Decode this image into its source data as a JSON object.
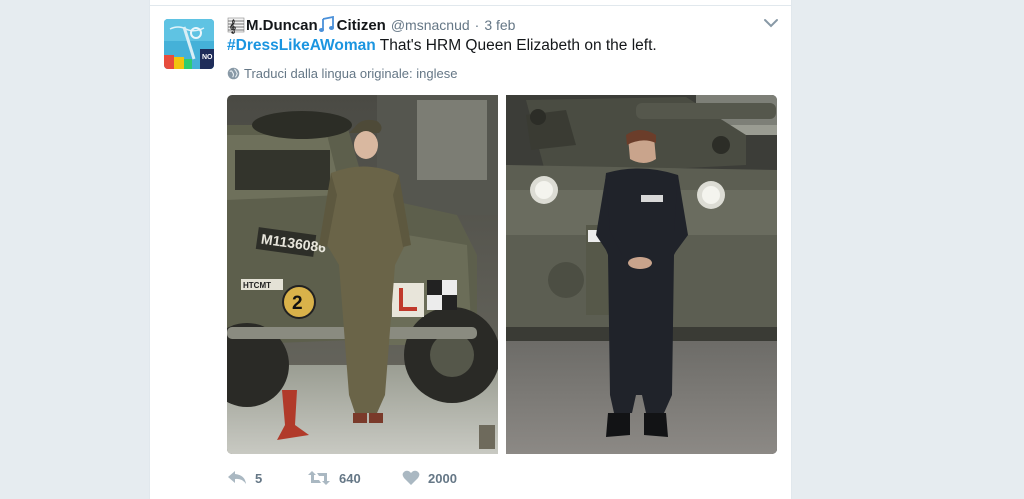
{
  "tweet": {
    "display_name": "M.Duncan",
    "display_name_suffix": "Citizen",
    "screen_name": "@msnacnud",
    "separator": "·",
    "timestamp": "3 feb",
    "hashtag": "#DressLikeAWoman",
    "text": " That's HRM Queen Elizabeth on the left.",
    "translate_label": "Traduci dalla lingua originale: inglese",
    "avatar_text": "NO"
  },
  "media": {
    "left_plate": "M1136086",
    "left_badge": "2",
    "left_sign": "HTCMT"
  },
  "actions": {
    "reply_count": "5",
    "retweet_count": "640",
    "like_count": "2000"
  },
  "colors": {
    "link": "#1b95e0",
    "muted": "#657786",
    "text": "#14171a",
    "border": "#e1e8ed",
    "background": "#e6ecf0"
  }
}
